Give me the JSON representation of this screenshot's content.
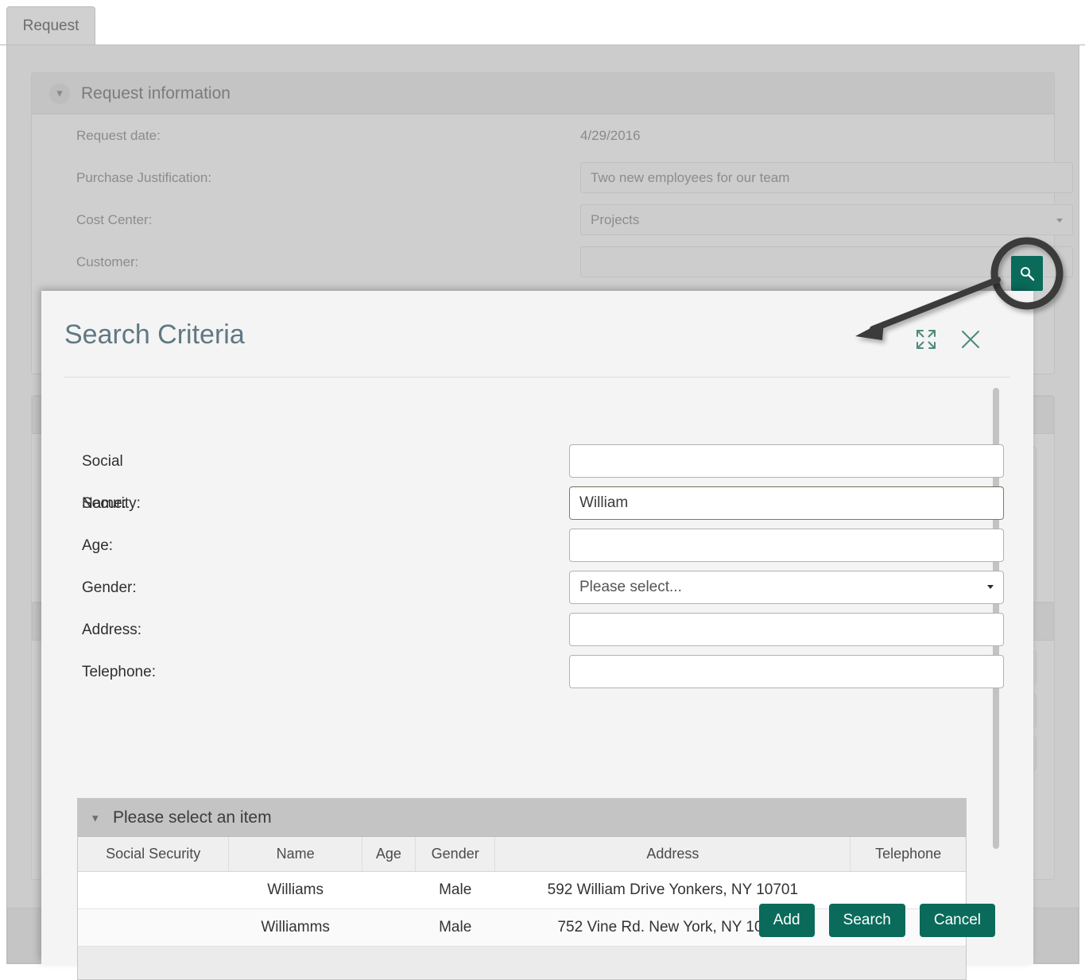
{
  "background": {
    "tab_label": "Request",
    "section_title": "Request information",
    "fields": [
      {
        "label": "Request date:",
        "value": "4/29/2016",
        "type": "static"
      },
      {
        "label": "Purchase Justification:",
        "value": "Two new employees for our team",
        "type": "text"
      },
      {
        "label": "Cost Center:",
        "value": "Projects",
        "type": "select"
      },
      {
        "label": "Customer:",
        "value": "",
        "type": "text"
      }
    ],
    "search_icon": "search-icon"
  },
  "dialog": {
    "title": "Search Criteria",
    "maximize_icon": "maximize-icon",
    "close_icon": "close-icon",
    "criteria": [
      {
        "label": "Social Security:",
        "value": "",
        "type": "text",
        "focused": false
      },
      {
        "label": "Name:",
        "value": "William",
        "type": "text",
        "focused": true
      },
      {
        "label": "Age:",
        "value": "",
        "type": "text",
        "focused": false
      },
      {
        "label": "Gender:",
        "value": "Please select...",
        "type": "select",
        "focused": false
      },
      {
        "label": "Address:",
        "value": "",
        "type": "text",
        "focused": false
      },
      {
        "label": "Telephone:",
        "value": "",
        "type": "text",
        "focused": false
      }
    ],
    "results": {
      "panel_title": "Please select an item",
      "collapse_icon": "chevron-down-icon",
      "columns": [
        "Social Security",
        "Name",
        "Age",
        "Gender",
        "Address",
        "Telephone"
      ],
      "rows": [
        {
          "social_security": "",
          "name": "Williams",
          "age": "",
          "gender": "Male",
          "address": "592 William Drive Yonkers, NY 10701",
          "telephone": ""
        },
        {
          "social_security": "",
          "name": "Williamms",
          "age": "",
          "gender": "Male",
          "address": "752 Vine Rd. New York, NY 10023",
          "telephone": ""
        }
      ]
    },
    "buttons": {
      "add": "Add",
      "search": "Search",
      "cancel": "Cancel"
    }
  },
  "colors": {
    "accent_teal": "#0a6b5b",
    "title_blue_gray": "#5f7883",
    "dialog_bg": "#f4f4f4",
    "app_bg": "#cccccc",
    "annotation": "#3a3a3a"
  }
}
